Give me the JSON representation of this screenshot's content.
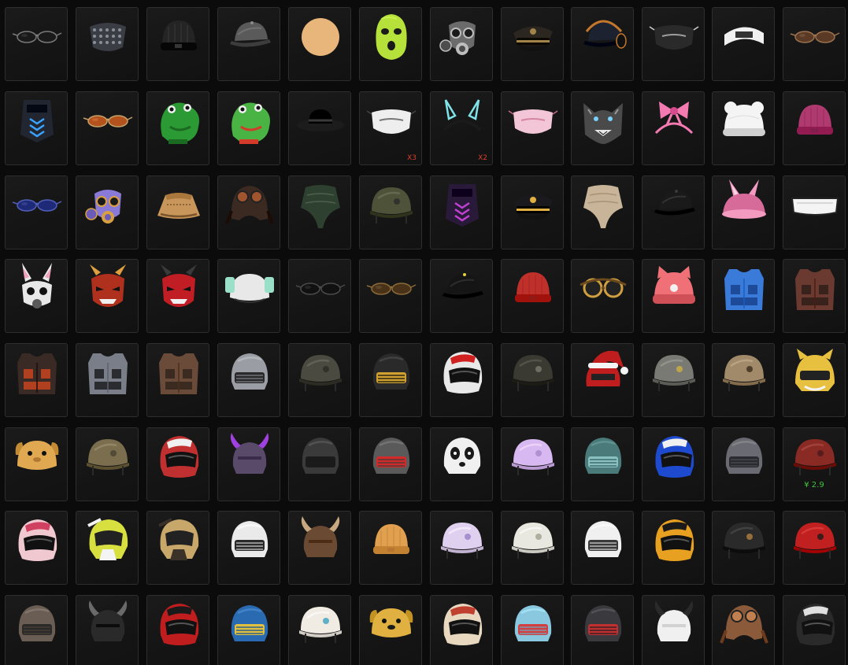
{
  "inventory": {
    "columns": 12,
    "rows": [
      [
        {
          "name": "sunglasses-icon",
          "kind": "glasses",
          "colors": [
            "#1a1a1a",
            "#7a7a7a"
          ]
        },
        {
          "name": "studded-mask-icon",
          "kind": "mask",
          "colors": [
            "#3a3d44",
            "#8a8f98"
          ]
        },
        {
          "name": "knit-beanie-icon",
          "kind": "beanie",
          "colors": [
            "#242424",
            "#4a4a4a"
          ]
        },
        {
          "name": "gray-cap-icon",
          "kind": "cap",
          "colors": [
            "#5a5a5a",
            "#8a8a8a"
          ]
        },
        {
          "name": "ice-cream-cone-icon",
          "kind": "icecream",
          "colors": [
            "#e8b57a",
            "#f4c3c8"
          ]
        },
        {
          "name": "green-balaclava-icon",
          "kind": "balaclava",
          "colors": [
            "#b6e03a",
            "#1a1a1a"
          ]
        },
        {
          "name": "gas-mask-icon",
          "kind": "gasmask",
          "colors": [
            "#6b6b6b",
            "#bdbdbd"
          ]
        },
        {
          "name": "officer-cap-black-icon",
          "kind": "officer",
          "colors": [
            "#2b2620",
            "#a0844a"
          ]
        },
        {
          "name": "headset-cap-icon",
          "kind": "headsetcap",
          "colors": [
            "#1d2230",
            "#c4772b"
          ]
        },
        {
          "name": "face-mask-black-icon",
          "kind": "facemask",
          "colors": [
            "#2a2a2a",
            "#d0d0d0"
          ]
        },
        {
          "name": "white-headband-icon",
          "kind": "headband",
          "colors": [
            "#f0f0f0",
            "#333333"
          ]
        },
        {
          "name": "round-glasses-icon",
          "kind": "glasses",
          "colors": [
            "#5a3a24",
            "#9a7250"
          ]
        }
      ],
      [
        {
          "name": "tactical-mask-blue-icon",
          "kind": "tacmask",
          "colors": [
            "#222630",
            "#3aa3ff"
          ]
        },
        {
          "name": "aviator-sunglasses-icon",
          "kind": "glasses",
          "colors": [
            "#b3521c",
            "#c4a26a"
          ]
        },
        {
          "name": "green-dinosaur-mask-icon",
          "kind": "dino",
          "colors": [
            "#2c9a34",
            "#1b6a22"
          ]
        },
        {
          "name": "green-frog-mask-icon",
          "kind": "dino",
          "colors": [
            "#49b344",
            "#d43a2a"
          ]
        },
        {
          "name": "black-fedora-icon",
          "kind": "fedora",
          "colors": [
            "#1c1c1c",
            "#3a3a3a"
          ]
        },
        {
          "name": "white-face-mask-icon",
          "kind": "facemask",
          "colors": [
            "#eeeeee",
            "#444444"
          ],
          "qty": "X3"
        },
        {
          "name": "bunny-ears-headband-icon",
          "kind": "ears",
          "colors": [
            "#1a1a1a",
            "#7fe3e8"
          ],
          "qty": "X2"
        },
        {
          "name": "pink-face-mask-icon",
          "kind": "facemask",
          "colors": [
            "#f2c6d6",
            "#c86a8a"
          ]
        },
        {
          "name": "wolf-mask-icon",
          "kind": "wolf",
          "colors": [
            "#4a4a4a",
            "#9a9a9a"
          ]
        },
        {
          "name": "pink-bow-headband-icon",
          "kind": "bow",
          "colors": [
            "#f47ab2",
            "#d64a8e"
          ]
        },
        {
          "name": "white-bear-beanie-icon",
          "kind": "bearhat",
          "colors": [
            "#f4f4f4",
            "#cfcfcf"
          ]
        },
        {
          "name": "magenta-beanie-icon",
          "kind": "beanie",
          "colors": [
            "#b03a70",
            "#7a2048"
          ]
        }
      ],
      [
        {
          "name": "blue-square-sunglasses-icon",
          "kind": "glasses",
          "colors": [
            "#1e2a78",
            "#5060b8"
          ]
        },
        {
          "name": "colorful-gas-mask-icon",
          "kind": "gasmask",
          "colors": [
            "#8a7ad8",
            "#d8a040"
          ]
        },
        {
          "name": "bucket-hat-icon",
          "kind": "bucket",
          "colors": [
            "#c8955a",
            "#7a542a"
          ]
        },
        {
          "name": "aviator-cap-goggles-icon",
          "kind": "aviator",
          "colors": [
            "#3a2a22",
            "#a0552e"
          ]
        },
        {
          "name": "green-bandana-icon",
          "kind": "bandana",
          "colors": [
            "#2e4030",
            "#5c6e5a"
          ]
        },
        {
          "name": "military-helmet-headset-icon",
          "kind": "milhelmet",
          "colors": [
            "#4e5238",
            "#2a2a2a"
          ]
        },
        {
          "name": "purple-pattern-mask-icon",
          "kind": "tacmask",
          "colors": [
            "#2a1a3a",
            "#c040d0"
          ]
        },
        {
          "name": "gold-officer-cap-icon",
          "kind": "officer",
          "colors": [
            "#1a1a1e",
            "#e0b040"
          ]
        },
        {
          "name": "tan-bandana-icon",
          "kind": "bandana",
          "colors": [
            "#c8b498",
            "#9a8468"
          ]
        },
        {
          "name": "black-cap-icon",
          "kind": "cap",
          "colors": [
            "#1a1a1a",
            "#3a3a3a"
          ]
        },
        {
          "name": "pink-bunny-hat-icon",
          "kind": "bunnyhat",
          "colors": [
            "#f29ac0",
            "#d66a98"
          ]
        },
        {
          "name": "white-visor-glasses-icon",
          "kind": "visor",
          "colors": [
            "#f4f4f4",
            "#222222"
          ]
        }
      ],
      [
        {
          "name": "bunny-gas-mask-icon",
          "kind": "bunnymask",
          "colors": [
            "#e8e8e8",
            "#5a5a5a"
          ]
        },
        {
          "name": "red-oni-mask-icon",
          "kind": "oni",
          "colors": [
            "#b0301e",
            "#e0a040"
          ]
        },
        {
          "name": "red-demon-mask-icon",
          "kind": "oni",
          "colors": [
            "#c01e24",
            "#3a3a3a"
          ]
        },
        {
          "name": "cartoon-helmet-icon",
          "kind": "cartoon",
          "colors": [
            "#9ae0c8",
            "#e8e8e8"
          ]
        },
        {
          "name": "black-visor-glasses-icon",
          "kind": "glasses",
          "colors": [
            "#111111",
            "#4a4a4a"
          ]
        },
        {
          "name": "brown-sunglasses-icon",
          "kind": "glasses",
          "colors": [
            "#4a3218",
            "#8a6a3a"
          ]
        },
        {
          "name": "black-yellow-cap-icon",
          "kind": "cap",
          "colors": [
            "#151515",
            "#e0d040"
          ]
        },
        {
          "name": "red-beanie-icon",
          "kind": "beanie",
          "colors": [
            "#c0302a",
            "#8a1e1a"
          ]
        },
        {
          "name": "steampunk-goggles-icon",
          "kind": "goggles",
          "colors": [
            "#6a4a1e",
            "#d0a040"
          ]
        },
        {
          "name": "pink-cat-beanie-icon",
          "kind": "catbeanie",
          "colors": [
            "#f07078",
            "#d05058"
          ]
        },
        {
          "name": "blue-armor-vest-icon",
          "kind": "vest",
          "colors": [
            "#3a7ad8",
            "#1e4a9a"
          ]
        },
        {
          "name": "brown-armor-vest-icon",
          "kind": "vest",
          "colors": [
            "#6a3a30",
            "#3a221c"
          ]
        }
      ],
      [
        {
          "name": "dark-armor-vest-icon",
          "kind": "vest",
          "colors": [
            "#3a2a26",
            "#b04020"
          ]
        },
        {
          "name": "camo-armor-vest-icon",
          "kind": "vest",
          "colors": [
            "#7a7e88",
            "#2a2c30"
          ]
        },
        {
          "name": "leather-vest-icon",
          "kind": "vest",
          "colors": [
            "#6a4a38",
            "#3a2a20"
          ]
        },
        {
          "name": "level3-helmet-icon",
          "kind": "spetsnaz",
          "colors": [
            "#9a9ea4",
            "#2a2a2a"
          ]
        },
        {
          "name": "military-helmet-icon",
          "kind": "milhelmet",
          "colors": [
            "#4a4a40",
            "#2a2a24"
          ]
        },
        {
          "name": "gold-stripe-helmet-icon",
          "kind": "spetsnaz",
          "colors": [
            "#2a2a2a",
            "#d0a030"
          ]
        },
        {
          "name": "racing-helmet-icon",
          "kind": "racing",
          "colors": [
            "#e8e8e8",
            "#d02020"
          ]
        },
        {
          "name": "goggle-helmet-icon",
          "kind": "milhelmet",
          "colors": [
            "#3a3a32",
            "#7a7a70"
          ]
        },
        {
          "name": "santa-helmet-icon",
          "kind": "santa",
          "colors": [
            "#c01e1e",
            "#f4f4f4"
          ]
        },
        {
          "name": "star-helmet-icon",
          "kind": "milhelmet",
          "colors": [
            "#7a7a74",
            "#d0b040"
          ]
        },
        {
          "name": "gold-mask-helmet-icon",
          "kind": "milhelmet",
          "colors": [
            "#a08a6a",
            "#3a2a1a"
          ]
        },
        {
          "name": "cat-ear-helmet-icon",
          "kind": "cathelmet",
          "colors": [
            "#e8c040",
            "#f4f4f4"
          ]
        }
      ],
      [
        {
          "name": "dog-helmet-icon",
          "kind": "doghelmet",
          "colors": [
            "#e0a850",
            "#b07830"
          ]
        },
        {
          "name": "tan-camo-helmet-icon",
          "kind": "milhelmet",
          "colors": [
            "#7a6e4e",
            "#4a4230"
          ]
        },
        {
          "name": "checker-helmet-icon",
          "kind": "racing",
          "colors": [
            "#c03030",
            "#f0f0f0"
          ]
        },
        {
          "name": "purple-horned-helmet-icon",
          "kind": "horned",
          "colors": [
            "#5a4a6a",
            "#a040e0"
          ]
        },
        {
          "name": "dark-spetsnaz-helmet-icon",
          "kind": "spetsnaz",
          "colors": [
            "#3a3a3a",
            "#1a1a1a"
          ]
        },
        {
          "name": "red-visor-helmet-icon",
          "kind": "spetsnaz",
          "colors": [
            "#5a5a5a",
            "#d02a2a"
          ]
        },
        {
          "name": "panda-helmet-icon",
          "kind": "panda",
          "colors": [
            "#f0f0f0",
            "#1a1a1a"
          ]
        },
        {
          "name": "lilac-helmet-icon",
          "kind": "milhelmet",
          "colors": [
            "#d8b8f0",
            "#a888c8"
          ]
        },
        {
          "name": "teal-pattern-helmet-icon",
          "kind": "spetsnaz",
          "colors": [
            "#4a7a7a",
            "#8ac0c0"
          ]
        },
        {
          "name": "blue-race-helmet-icon",
          "kind": "racing",
          "colors": [
            "#1e4ad0",
            "#f0f0f0"
          ]
        },
        {
          "name": "gray-spetsnaz-helmet-icon",
          "kind": "spetsnaz",
          "colors": [
            "#6a6a72",
            "#2a2a30"
          ]
        },
        {
          "name": "red-camo-helmet-icon",
          "kind": "milhelmet",
          "colors": [
            "#8a2a24",
            "#4a1a1a"
          ],
          "price": "¥ 2.9"
        }
      ],
      [
        {
          "name": "striped-open-helmet-icon",
          "kind": "racing",
          "colors": [
            "#f0c8d0",
            "#d04060"
          ]
        },
        {
          "name": "yellow-motocross-helmet-icon",
          "kind": "moto",
          "colors": [
            "#d8e040",
            "#f4f4f4"
          ]
        },
        {
          "name": "gold-motocross-helmet-icon",
          "kind": "moto",
          "colors": [
            "#c8a86a",
            "#3a3228"
          ]
        },
        {
          "name": "white-spetsnaz-helmet-icon",
          "kind": "spetsnaz",
          "colors": [
            "#eaeaea",
            "#2a2a2a"
          ]
        },
        {
          "name": "viking-helmet-icon",
          "kind": "horned",
          "colors": [
            "#6a4a32",
            "#c8a880"
          ]
        },
        {
          "name": "orange-knit-helmet-icon",
          "kind": "beanie",
          "colors": [
            "#e0a050",
            "#b07030"
          ]
        },
        {
          "name": "lilac-cartoon-helmet-icon",
          "kind": "milhelmet",
          "colors": [
            "#e0d0f0",
            "#9a80c8"
          ]
        },
        {
          "name": "ornate-white-helmet-icon",
          "kind": "milhelmet",
          "colors": [
            "#e8e8e0",
            "#a0a090"
          ]
        },
        {
          "name": "winged-white-helmet-icon",
          "kind": "spetsnaz",
          "colors": [
            "#f0f0f0",
            "#3a3a3a"
          ]
        },
        {
          "name": "tiger-race-helmet-icon",
          "kind": "racing",
          "colors": [
            "#e8a020",
            "#1a1a1a"
          ]
        },
        {
          "name": "bronze-open-helmet-icon",
          "kind": "milhelmet",
          "colors": [
            "#2a2a2a",
            "#b08040"
          ]
        },
        {
          "name": "red-plaid-helmet-icon",
          "kind": "milhelmet",
          "colors": [
            "#c02020",
            "#1a1a1a"
          ]
        }
      ],
      [
        {
          "name": "gray-rag-helmet-icon",
          "kind": "spetsnaz",
          "colors": [
            "#6a5e54",
            "#2a2a2a"
          ]
        },
        {
          "name": "spiked-helmet-icon",
          "kind": "horned",
          "colors": [
            "#2a2a2a",
            "#6a6a6a"
          ]
        },
        {
          "name": "red-full-helmet-icon",
          "kind": "racing",
          "colors": [
            "#c01e1e",
            "#1a1a1a"
          ]
        },
        {
          "name": "blue-monster-helmet-icon",
          "kind": "spetsnaz",
          "colors": [
            "#2a6ab0",
            "#e0c040"
          ]
        },
        {
          "name": "white-beaded-helmet-icon",
          "kind": "milhelmet",
          "colors": [
            "#f0ece4",
            "#3aa0c0"
          ]
        },
        {
          "name": "yellow-monster-helmet-icon",
          "kind": "doghelmet",
          "colors": [
            "#e0b040",
            "#1a1a1a"
          ]
        },
        {
          "name": "painted-open-helmet-icon",
          "kind": "racing",
          "colors": [
            "#e8d8c0",
            "#c04030"
          ]
        },
        {
          "name": "blue-pattern-helmet-icon",
          "kind": "spetsnaz",
          "colors": [
            "#8ac8e0",
            "#d04040"
          ]
        },
        {
          "name": "mohawk-helmet-icon",
          "kind": "spetsnaz",
          "colors": [
            "#3a3a3e",
            "#c03030"
          ]
        },
        {
          "name": "cow-horn-helmet-icon",
          "kind": "horned",
          "colors": [
            "#f0f0f0",
            "#2a2a2a"
          ]
        },
        {
          "name": "leather-aviator-helmet-icon",
          "kind": "aviator",
          "colors": [
            "#8a5a3a",
            "#c08050"
          ]
        },
        {
          "name": "checkered-helmet-icon",
          "kind": "racing",
          "colors": [
            "#2a2a2a",
            "#e0e0e0"
          ]
        }
      ]
    ]
  }
}
